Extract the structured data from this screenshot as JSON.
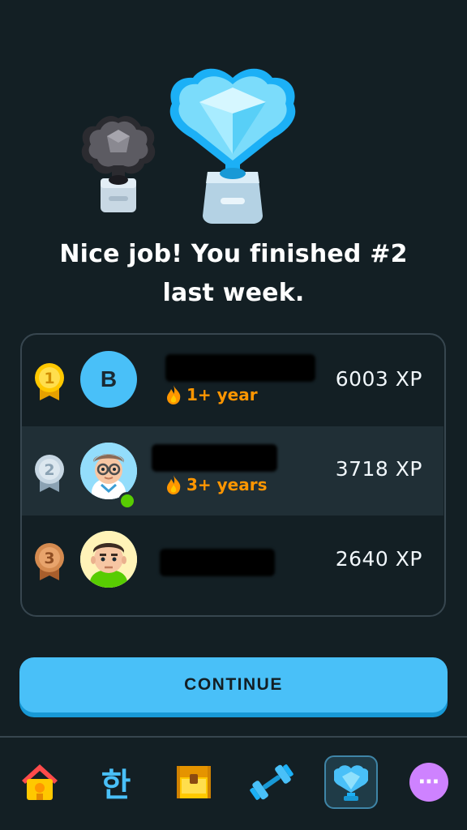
{
  "headline": "Nice job! You finished #2 last week.",
  "leaderboard": [
    {
      "rank": "1",
      "medal": "gold-medal",
      "avatar_letter": "B",
      "streak": "1+ year",
      "xp": "6003 XP"
    },
    {
      "rank": "2",
      "medal": "silver-medal",
      "avatar": "glasses-avatar",
      "streak": "3+ years",
      "xp": "3718 XP"
    },
    {
      "rank": "3",
      "medal": "bronze-medal",
      "avatar": "duo-character-avatar",
      "streak": "",
      "xp": "2640 XP"
    }
  ],
  "continue_label": "CONTINUE",
  "nav": {
    "items": [
      {
        "icon": "home-icon"
      },
      {
        "icon": "korean-letter-icon",
        "label": "한"
      },
      {
        "icon": "treasure-chest-icon"
      },
      {
        "icon": "dumbbell-icon"
      },
      {
        "icon": "leaderboard-trophy-icon",
        "active": true
      },
      {
        "icon": "more-icon"
      }
    ]
  },
  "colors": {
    "background": "#131f24",
    "accent": "#49c0f8",
    "streak": "#ff9600",
    "active_border": "#3f85a7"
  }
}
